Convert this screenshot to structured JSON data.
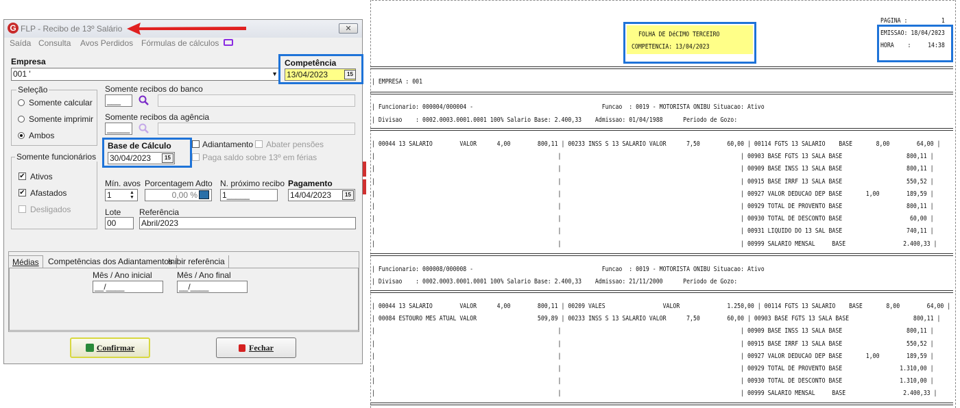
{
  "window": {
    "title": "FLP - Recibo de 13º Salário",
    "close_label": "✕",
    "logo_letter": "G",
    "menu": [
      "Saída",
      "Consulta",
      "Avos Perdidos",
      "Fórmulas de cálculos"
    ]
  },
  "form": {
    "empresa_label": "Empresa",
    "empresa_value": "001 '",
    "competencia_label": "Competência",
    "competencia_value": "13/04/2023",
    "selecao_label": "Seleção",
    "selecao_options": [
      "Somente calcular",
      "Somente imprimir",
      "Ambos"
    ],
    "selecao_selected": "Ambos",
    "banco_label": "Somente recibos do banco",
    "banco_value": "___",
    "agencia_label": "Somente recibos da agência",
    "agencia_value": "_____",
    "funcionarios_label": "Somente funcionários",
    "funcionarios": [
      {
        "label": "Ativos",
        "checked": true,
        "enabled": true
      },
      {
        "label": "Afastados",
        "checked": true,
        "enabled": true
      },
      {
        "label": "Desligados",
        "checked": false,
        "enabled": false
      }
    ],
    "base_calculo_label": "Base de Cálculo",
    "base_calculo_value": "30/04/2023",
    "adiantamento_label": "Adiantamento",
    "abater_label": "Abater pensões",
    "paga_saldo_label": "Paga saldo sobre 13º em férias",
    "min_avos_label": "Mín. avos",
    "min_avos_value": "1",
    "porcentagem_label": "Porcentagem Adto",
    "porcentagem_value": "0,00 %",
    "proximo_recibo_label": "N. próximo recibo",
    "proximo_recibo_value": "1_____",
    "pagamento_label": "Pagamento",
    "pagamento_value": "14/04/2023",
    "lote_label": "Lote",
    "lote_value": "00",
    "referencia_label": "Referência",
    "referencia_value": "Abril/2023",
    "calendar_glyph": "15"
  },
  "tabs": {
    "items": [
      "Médias",
      "Competências dos Adiantamentos",
      "Inibir referência"
    ],
    "active": "Médias",
    "mes_inicial_label": "Mês / Ano inicial",
    "mes_inicial_value": "__/____",
    "mes_final_label": "Mês / Ano final",
    "mes_final_value": "__/____"
  },
  "buttons": {
    "confirmar": "Confirmar",
    "fechar": "Fechar"
  },
  "report": {
    "pagina": "PAGINA :          1",
    "titulo": "FOLHA DE DéCIMO TERCEIRO",
    "competencia": "COMPETENCIA: 13/04/2023",
    "emissao": "EMISSAO: 18/04/2023",
    "hora": "HORA    :     14:38",
    "empresa": "| EMPRESA : 001",
    "lines_a": [
      "| Funcionario: 000004/000004 -                                      Funcao  : 0019 - MOTORISTA ONIBU Situacao: Ativo",
      "| Divisao    : 0002.0003.0001.0001 100% Salario Base: 2.400,33    Admissao: 01/04/1988      Periodo de Gozo:"
    ],
    "rows_a": [
      "| 00044 13 SALARIO        VALOR      4,00        800,11 | 00233 INSS S 13 SALARIO VALOR      7,50        60,00 | 00114 FGTS 13 SALARIO    BASE       8,00        64,00 |",
      "|                                                      |                                                     | 00903 BASE FGTS 13 SALA BASE                   800,11 |",
      "|                                                      |                                                     | 00909 BASE INSS 13 SALA BASE                   800,11 |",
      "|                                                      |                                                     | 00915 BASE IRRF 13 SALA BASE                   550,52 |",
      "|                                                      |                                                     | 00927 VALOR DEDUCAO DEP BASE       1,00        189,59 |",
      "|                                                      |                                                     | 00929 TOTAL DE PROVENTO BASE                   800,11 |",
      "|                                                      |                                                     | 00930 TOTAL DE DESCONTO BASE                    60,00 |",
      "|                                                      |                                                     | 00931 LIQUIDO DO 13 SAL BASE                   740,11 |",
      "|                                                      |                                                     | 00999 SALARIO MENSAL     BASE                 2.400,33 |"
    ],
    "lines_b": [
      "| Funcionario: 000008/000008 -                                      Funcao  : 0019 - MOTORISTA ONIBU Situacao: Ativo",
      "| Divisao    : 0002.0003.0001.0001 100% Salario Base: 2.400,33    Admissao: 21/11/2000      Periodo de Gozo:"
    ],
    "rows_b": [
      "| 00044 13 SALARIO        VALOR      4,00        800,11 | 00209 VALES                 VALOR              1.250,00 | 00114 FGTS 13 SALARIO    BASE       8,00        64,00 |",
      "| 00084 ESTOURO MES ATUAL VALOR                  509,89 | 00233 INSS S 13 SALARIO VALOR      7,50        60,00 | 00903 BASE FGTS 13 SALA BASE                   800,11 |",
      "|                                                      |                                                     | 00909 BASE INSS 13 SALA BASE                   800,11 |",
      "|                                                      |                                                     | 00915 BASE IRRF 13 SALA BASE                   550,52 |",
      "|                                                      |                                                     | 00927 VALOR DEDUCAO DEP BASE       1,00        189,59 |",
      "|                                                      |                                                     | 00929 TOTAL DE PROVENTO BASE                 1.310,00 |",
      "|                                                      |                                                     | 00930 TOTAL DE DESCONTO BASE                 1.310,00 |",
      "|                                                      |                                                     | 00999 SALARIO MENSAL     BASE                 2.400,33 |"
    ]
  },
  "colors": {
    "highlight_border": "#1e73d8",
    "highlight_fill": "#ffff88",
    "arrow": "#e02020",
    "logo": "#c82a2a"
  }
}
